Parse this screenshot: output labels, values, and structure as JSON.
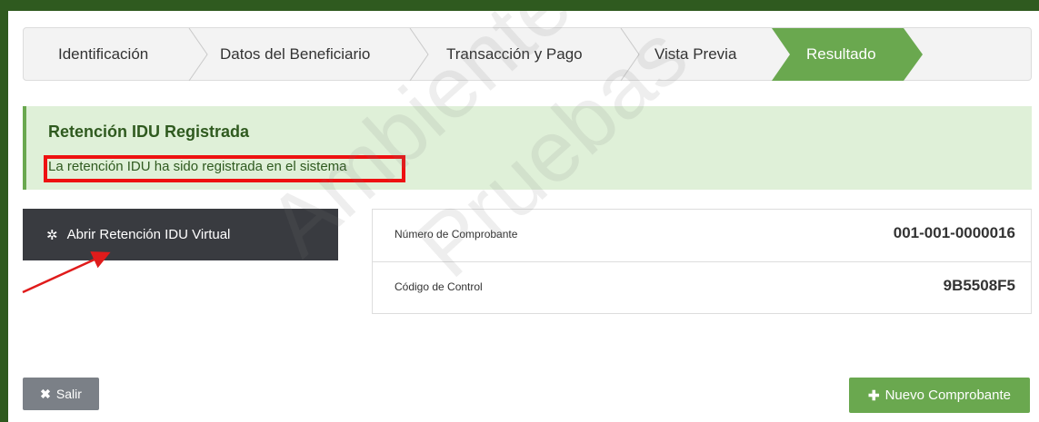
{
  "wizard": {
    "steps": [
      {
        "label": "Identificación",
        "active": false
      },
      {
        "label": "Datos del Beneficiario",
        "active": false
      },
      {
        "label": "Transacción y Pago",
        "active": false
      },
      {
        "label": "Vista Previa",
        "active": false
      },
      {
        "label": "Resultado",
        "active": true
      }
    ]
  },
  "alert": {
    "title": "Retención IDU Registrada",
    "message": "La retención IDU ha sido registrada en el sistema"
  },
  "virtual_button": {
    "icon": "gear-icon",
    "label": "Abrir Retención IDU Virtual"
  },
  "info": {
    "rows": [
      {
        "label": "Número de Comprobante",
        "value": "001-001-0000016"
      },
      {
        "label": "Código de Control",
        "value": "9B5508F5"
      }
    ]
  },
  "buttons": {
    "exit": {
      "icon": "close-icon",
      "label": "Salir"
    },
    "new": {
      "icon": "plus-icon",
      "label": "Nuevo Comprobante"
    }
  },
  "watermark": {
    "line1": "Ambiente",
    "line2": "Pruebas"
  },
  "colors": {
    "accent_green": "#6aa84f",
    "alert_bg": "#dff0d8",
    "dark_button": "#393b40",
    "exit_button": "#7b8087",
    "highlight_red": "#ee1111"
  }
}
